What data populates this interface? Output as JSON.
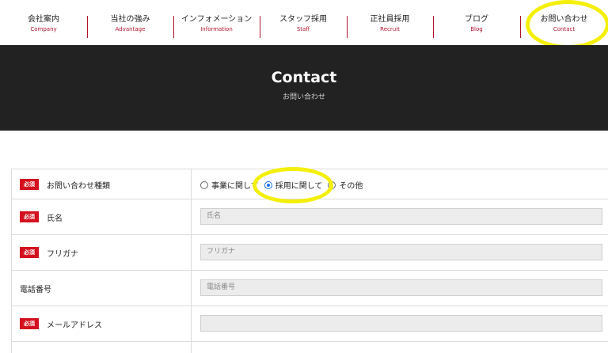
{
  "nav": {
    "items": [
      {
        "jp": "会社案内",
        "en": "Company"
      },
      {
        "jp": "当社の強み",
        "en": "Advantage"
      },
      {
        "jp": "インフォメーション",
        "en": "Information"
      },
      {
        "jp": "スタッフ採用",
        "en": "Staff"
      },
      {
        "jp": "正社員採用",
        "en": "Recruit"
      },
      {
        "jp": "ブログ",
        "en": "Blog"
      },
      {
        "jp": "お問い合わせ",
        "en": "Contact"
      }
    ]
  },
  "hero": {
    "title": "Contact",
    "subtitle": "お問い合わせ"
  },
  "form": {
    "required_badge": "必須",
    "inquiry_type": {
      "label": "お問い合わせ種類",
      "options": [
        "事業に関して",
        "採用に関して",
        "その他"
      ],
      "selected": "採用に関して"
    },
    "name": {
      "label": "氏名",
      "placeholder": "氏名"
    },
    "furigana": {
      "label": "フリガナ",
      "placeholder": "フリガナ"
    },
    "phone": {
      "label": "電話番号",
      "placeholder": "電話番号"
    },
    "email": {
      "label": "メールアドレス",
      "placeholder": ""
    }
  },
  "colors": {
    "accent": "#b0122a",
    "required": "#d4101e",
    "hero_bg": "#222222",
    "highlight": "#f4ef0a"
  }
}
